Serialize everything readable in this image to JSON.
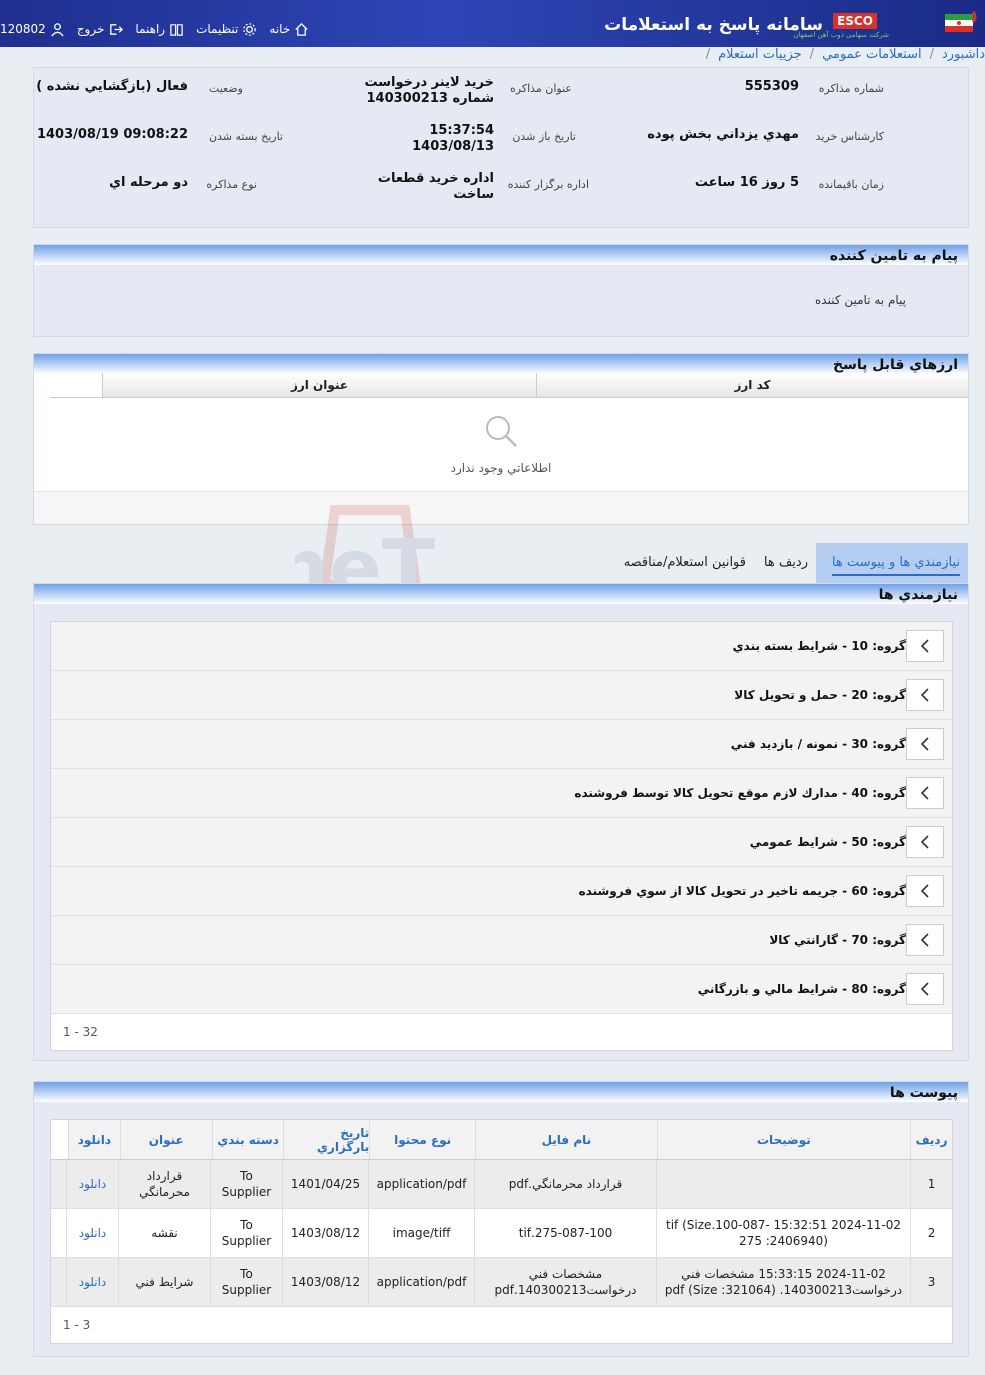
{
  "header": {
    "system_title": "سامانه پاسخ به استعلامات",
    "brand": "ESCO",
    "brand_sub": "شرکت سهامی ذوب آهن اصفهان",
    "nav": [
      {
        "label": "خانه",
        "icon": "home-icon"
      },
      {
        "label": "تنظيمات",
        "icon": "gear-icon"
      },
      {
        "label": "راهنما",
        "icon": "book-icon"
      },
      {
        "label": "خروج",
        "icon": "logout-icon"
      },
      {
        "label": "120802",
        "icon": "user-icon"
      }
    ]
  },
  "breadcrumb": [
    "داشبورد",
    "استعلامات عمومي",
    "جزييات استعلام"
  ],
  "info": {
    "negotiation_number_label": "شماره مذاکره",
    "negotiation_number": "555309",
    "title_label": "عنوان مذاکره",
    "title_line1": "خريد لاينر درخواست",
    "title_line2": "شماره 140300213",
    "status_label": "وضعيت",
    "status": "فعال (بازگشايي نشده )",
    "buyer_label": "کارشناس خريد",
    "buyer": "مهدي يزداني بخش پوده",
    "open_date_label": "تاريخ باز شدن",
    "open_time": "15:37:54",
    "open_date": "1403/08/13",
    "close_date_label": "تاريخ بسته شدن",
    "close_date": "1403/08/19 09:08:22",
    "remaining_label": "زمان باقيمانده",
    "remaining": "5 روز 16 ساعت",
    "organizer_label": "اداره برگزار کننده",
    "organizer_line1": "اداره خريد قطعات",
    "organizer_line2": "ساخت",
    "type_label": "نوع مذاکره",
    "type": "دو مرحله اي"
  },
  "supplier_message": {
    "title": "پيام به تامين كننده",
    "text": "پيام به تامين کننده"
  },
  "currencies": {
    "title": "ارزهاي قابل پاسخ",
    "columns": [
      "کد ارز",
      "عنوان ارز"
    ],
    "empty_text": "اطلاعاتي وجود ندارد"
  },
  "tabs": [
    "نيازمندي ها و پيوست ها",
    "رديف ها",
    "قوانين استعلام/مناقصه"
  ],
  "requirements": {
    "title": "نيازمندي ها",
    "groups": [
      "گروه: 10 - شرايط بسته بندي",
      "گروه: 20 - حمل و تحويل كالا",
      "گروه: 30 - نمونه / بازديد فني",
      "گروه: 40 - مدارك لازم موقع تحويل كالا توسط فروشنده",
      "گروه: 50 - شرايط عمومي",
      "گروه: 60 - جريمه تاخير در تحويل كالا از سوي فروشنده",
      "گروه: 70 - گارانتي كالا",
      "گروه: 80 - شرايط مالي و بازرگاني"
    ],
    "pager": "1 - 32"
  },
  "attachments": {
    "title": "پيوست ها",
    "columns": [
      "رديف",
      "توضيحات",
      "نام فايل",
      "نوع محتوا",
      "تاريخ بارگزاري",
      "دسته بندي",
      "عنوان",
      "دانلود"
    ],
    "rows": [
      {
        "n": "1",
        "desc": "",
        "file": "قرارداد محرمانگي.pdf",
        "type": "application/pdf",
        "date": "1401/04/25",
        "cat": "To Supplier",
        "title": "قرارداد محرمانگي",
        "dl": "دانلود"
      },
      {
        "n": "2",
        "desc": "2024-11-02 15:32:51 tif (Size.100-087-275 :2406940)",
        "file": "275-087-100.tif",
        "type": "image/tiff",
        "date": "1403/08/12",
        "cat": "To Supplier",
        "title": "نقشه",
        "dl": "دانلود"
      },
      {
        "n": "3",
        "desc": "2024-11-02 15:33:15 مشخصات فني درخواست140300213. pdf (Size :321064)",
        "file": "مشخصات فني درخواست140300213.pdf",
        "type": "application/pdf",
        "date": "1403/08/12",
        "cat": "To Supplier",
        "title": "شرايط فني",
        "dl": "دانلود"
      }
    ],
    "pager": "1 - 3"
  },
  "watermark": "AriaTender.neT"
}
